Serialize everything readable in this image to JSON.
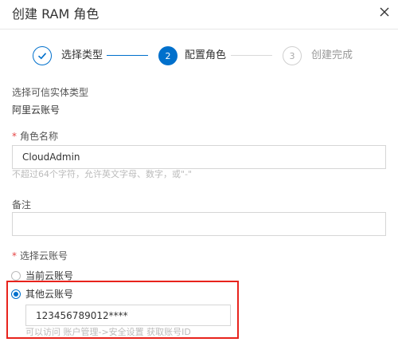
{
  "dialog": {
    "title": "创建 RAM 角色"
  },
  "steps": [
    {
      "label": "选择类型",
      "state": "done"
    },
    {
      "number": "2",
      "label": "配置角色",
      "state": "active"
    },
    {
      "number": "3",
      "label": "创建完成",
      "state": "pending"
    }
  ],
  "trusted_entity": {
    "label": "选择可信实体类型",
    "value": "阿里云账号"
  },
  "role_name": {
    "required_mark": "*",
    "label": "角色名称",
    "value": "CloudAdmin",
    "hint": "不超过64个字符，允许英文字母、数字，或\"-\""
  },
  "remark": {
    "label": "备注",
    "value": ""
  },
  "account": {
    "required_mark": "*",
    "label": "选择云账号",
    "options": [
      {
        "label": "当前云账号",
        "selected": false
      },
      {
        "label": "其他云账号",
        "selected": true
      }
    ],
    "account_id_value": "123456789012****",
    "hint": "可以访问 账户管理->安全设置 获取账号ID"
  },
  "colors": {
    "primary": "#0070cc",
    "highlight_border": "#e8231c",
    "required": "#e54545"
  },
  "icons": {
    "close": "close-icon",
    "step_done": "check-icon"
  }
}
